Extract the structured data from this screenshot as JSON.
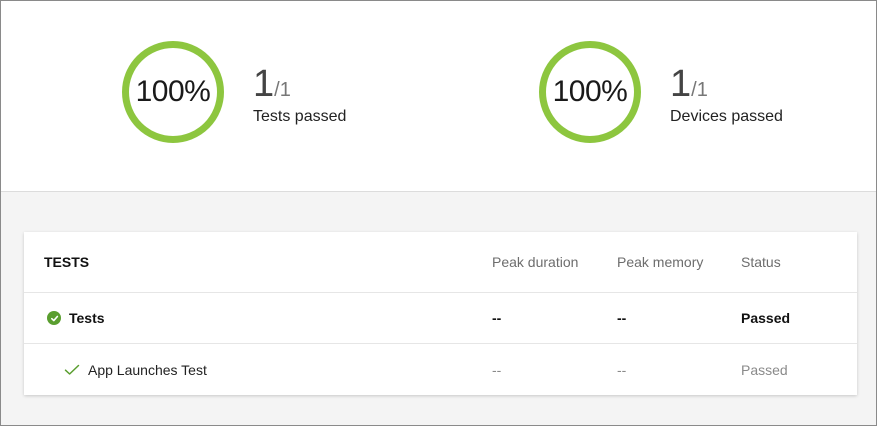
{
  "summary": {
    "tests": {
      "percent_text": "100%",
      "passed": "1",
      "total": "/1",
      "label": "Tests passed"
    },
    "devices": {
      "percent_text": "100%",
      "passed": "1",
      "total": "/1",
      "label": "Devices passed"
    },
    "ring_color": "#8dc63f"
  },
  "table": {
    "header": {
      "title": "TESTS",
      "peak_duration": "Peak duration",
      "peak_memory": "Peak memory",
      "status": "Status"
    },
    "group": {
      "name": "Tests",
      "peak_duration": "--",
      "peak_memory": "--",
      "status": "Passed",
      "icon": "check-circle-icon"
    },
    "items": [
      {
        "name": "App Launches Test",
        "peak_duration": "--",
        "peak_memory": "--",
        "status": "Passed",
        "icon": "checkmark-icon"
      }
    ],
    "success_color": "#5a9e2f"
  }
}
